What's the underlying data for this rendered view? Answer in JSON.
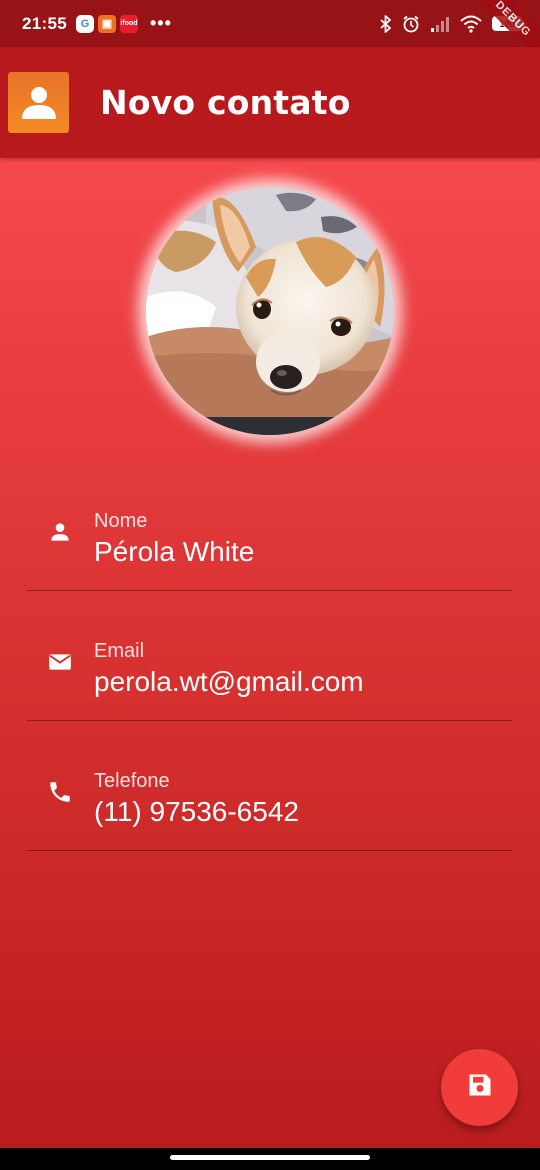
{
  "status_bar": {
    "time": "21:55",
    "apps": [
      {
        "name": "google-app-icon",
        "glyph": "G"
      },
      {
        "name": "orange-app-icon",
        "glyph": "▣"
      },
      {
        "name": "ifood-app-icon",
        "glyph": "ifood"
      }
    ],
    "more": "•••",
    "battery": "100",
    "debug_banner": "DEBUG"
  },
  "app_bar": {
    "title": "Novo contato",
    "icon": "contact-person-icon"
  },
  "avatar": {
    "icon": "contact-photo-dog"
  },
  "fields": [
    {
      "label": "Nome",
      "value": "Pérola White",
      "icon": "person-icon"
    },
    {
      "label": "Email",
      "value": "perola.wt@gmail.com",
      "icon": "mail-icon"
    },
    {
      "label": "Telefone",
      "value": "(11) 97536-6542",
      "icon": "phone-icon"
    }
  ],
  "fab": {
    "icon": "save-icon"
  },
  "colors": {
    "status_bar": "#981316",
    "app_bar": "#b7191c",
    "background_top": "#ff5155",
    "background_bottom": "#b91c1f",
    "fab": "#f23c3a",
    "app_icon": "#f28a24"
  }
}
